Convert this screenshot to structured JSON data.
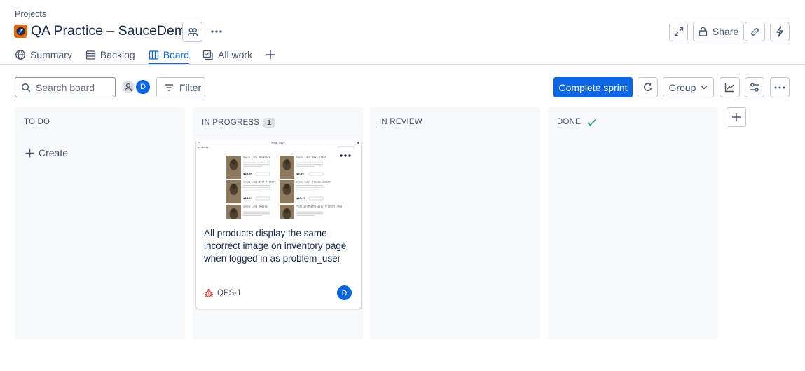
{
  "breadcrumb": "Projects",
  "project": {
    "title": "QA Practice – SauceDemo"
  },
  "header_actions": {
    "share_label": "Share"
  },
  "tabs": [
    {
      "label": "Summary",
      "icon": "globe-icon"
    },
    {
      "label": "Backlog",
      "icon": "backlog-icon"
    },
    {
      "label": "Board",
      "icon": "board-icon",
      "active": true
    },
    {
      "label": "All work",
      "icon": "all-work-icon"
    }
  ],
  "toolbar": {
    "search_placeholder": "Search board",
    "avatar_initial": "D",
    "filter_label": "Filter",
    "complete_sprint_label": "Complete sprint",
    "group_label": "Group"
  },
  "columns": [
    {
      "title": "TO DO",
      "create_label": "Create"
    },
    {
      "title": "IN PROGRESS",
      "count": "1"
    },
    {
      "title": "IN REVIEW"
    },
    {
      "title": "DONE"
    }
  ],
  "card": {
    "title": "All products display the same incorrect image on inventory page when logged in as problem_user",
    "key": "QPS-1",
    "assignee_initial": "D",
    "thumbnail": {
      "header": "Swag Labs",
      "sort_label": "Products",
      "items": [
        {
          "name": "Sauce Labs Backpack",
          "price": "$29.99"
        },
        {
          "name": "Sauce Labs Bike Light",
          "price": "$9.99"
        },
        {
          "name": "Sauce Labs Bolt T-Shirt",
          "price": "$15.99"
        },
        {
          "name": "Sauce Labs Fleece Jacket",
          "price": "$49.99"
        },
        {
          "name": "Sauce Labs Onesie",
          "price": ""
        },
        {
          "name": "Test.allTheThings() T-Shirt (Red)",
          "price": ""
        }
      ]
    }
  },
  "colors": {
    "primary": "#0c66e4",
    "avatar": "#0c66e4",
    "bug": "#e2483d",
    "done_check": "#22a06b",
    "column_bg": "#f7f8f9"
  }
}
